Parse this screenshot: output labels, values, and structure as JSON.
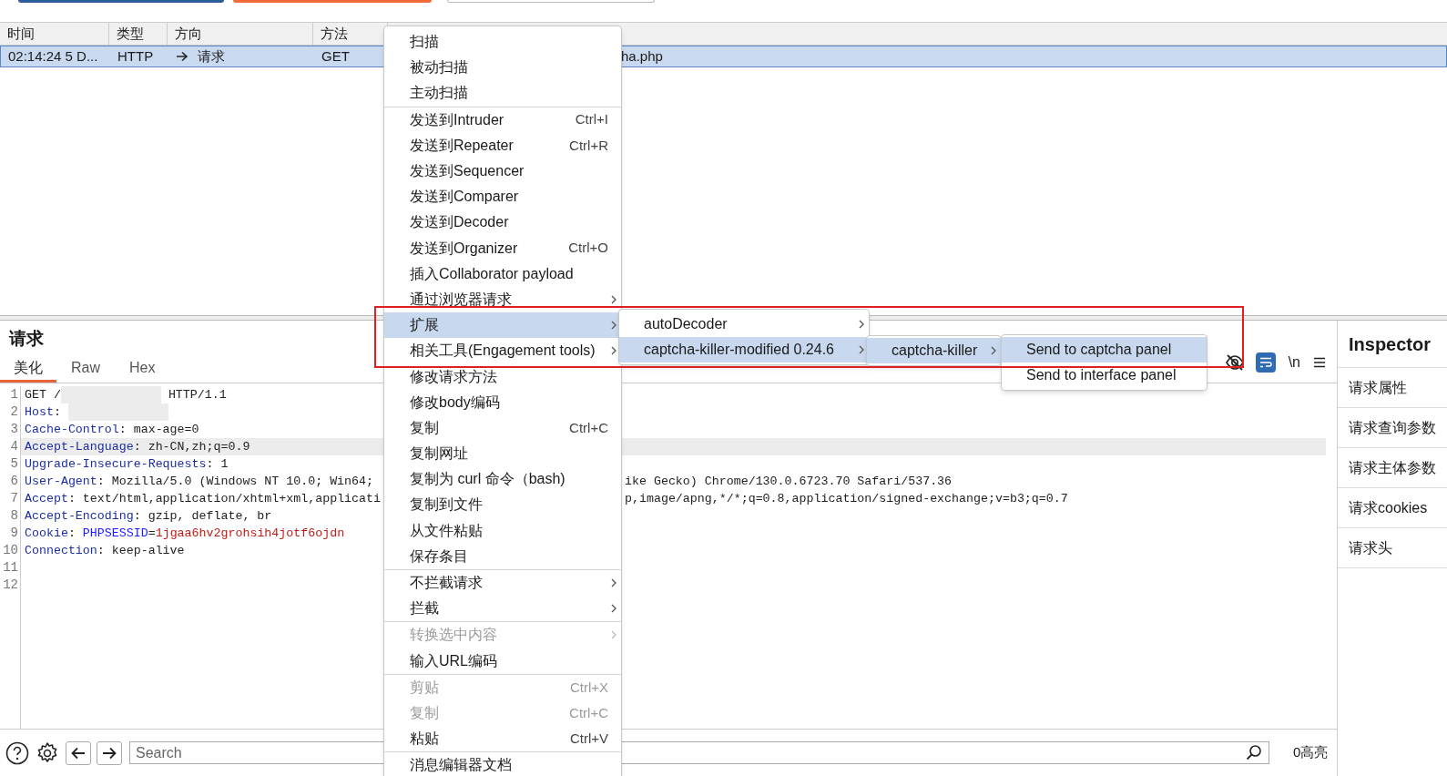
{
  "table": {
    "columns": [
      "时间",
      "类型",
      "方向",
      "方法"
    ],
    "rows": [
      {
        "selected": true,
        "time": "02:14:24 5 D...",
        "type": "HTTP",
        "direction": "请求",
        "method": "GET",
        "column_5": "ha.php"
      }
    ]
  },
  "request": {
    "title": "请求",
    "tabs": [
      {
        "label": "美化",
        "selected": true
      },
      {
        "label": "Raw",
        "selected": false
      },
      {
        "label": "Hex",
        "selected": false
      }
    ],
    "wrap_on": true,
    "newline_label": "\\n",
    "lines": [
      {
        "number": "1",
        "highlighted": false,
        "segments": [
          {
            "kind": "plain",
            "text": "GET /"
          },
          {
            "kind": "redacted"
          },
          {
            "kind": "plain",
            "text": " HTTP/1.1"
          }
        ]
      },
      {
        "number": "2",
        "highlighted": false,
        "segments": [
          {
            "kind": "key",
            "text": "Host"
          },
          {
            "kind": "plain",
            "text": ": "
          },
          {
            "kind": "redacted"
          }
        ]
      },
      {
        "number": "3",
        "highlighted": false,
        "segments": [
          {
            "kind": "key",
            "text": "Cache-Control"
          },
          {
            "kind": "plain",
            "text": ": max-age=0"
          }
        ]
      },
      {
        "number": "4",
        "highlighted": true,
        "segments": [
          {
            "kind": "key",
            "text": "Accept-Language"
          },
          {
            "kind": "plain",
            "text": ": zh-CN,zh;q=0.9"
          }
        ]
      },
      {
        "number": "5",
        "highlighted": false,
        "segments": [
          {
            "kind": "key",
            "text": "Upgrade-Insecure-Requests"
          },
          {
            "kind": "plain",
            "text": ": 1"
          }
        ]
      },
      {
        "number": "6",
        "highlighted": false,
        "segments": [
          {
            "kind": "key",
            "text": "User-Agent"
          },
          {
            "kind": "plain",
            "text": ": Mozilla/5.0 (Windows NT 10.0; Win64;"
          }
        ],
        "continuation": "ike Gecko) Chrome/130.0.6723.70 Safari/537.36"
      },
      {
        "number": "7",
        "highlighted": false,
        "segments": [
          {
            "kind": "key",
            "text": "Accept"
          },
          {
            "kind": "plain",
            "text": ": text/html,application/xhtml+xml,applicati"
          }
        ],
        "continuation": "p,image/apng,*/*;q=0.8,application/signed-exchange;v=b3;q=0.7"
      },
      {
        "number": "8",
        "highlighted": false,
        "segments": [
          {
            "kind": "key",
            "text": "Accept-Encoding"
          },
          {
            "kind": "plain",
            "text": ": gzip, deflate, br"
          }
        ]
      },
      {
        "number": "9",
        "highlighted": false,
        "segments": [
          {
            "kind": "key",
            "text": "Cookie"
          },
          {
            "kind": "plain",
            "text": ": "
          },
          {
            "kind": "param",
            "text": "PHPSESSID"
          },
          {
            "kind": "plain",
            "text": "="
          },
          {
            "kind": "value",
            "text": "1jgaa6hv2grohsih4jotf6ojdn"
          }
        ]
      },
      {
        "number": "10",
        "highlighted": false,
        "segments": [
          {
            "kind": "key",
            "text": "Connection"
          },
          {
            "kind": "plain",
            "text": ": keep-alive"
          }
        ]
      },
      {
        "number": "11",
        "highlighted": false
      },
      {
        "number": "12",
        "highlighted": false
      }
    ]
  },
  "inspector": {
    "title": "Inspector",
    "items": [
      "请求属性",
      "请求查询参数",
      "请求主体参数",
      "请求cookies",
      "请求头"
    ]
  },
  "bottom_bar": {
    "search_placeholder": "Search",
    "highlight_count": "0高亮"
  },
  "context_menu": {
    "items": [
      {
        "kind": "item",
        "label": "扫描",
        "submenu": false,
        "disabled": false,
        "selected": false
      },
      {
        "kind": "item",
        "label": "被动扫描",
        "submenu": false,
        "disabled": false,
        "selected": false
      },
      {
        "kind": "item",
        "label": "主动扫描",
        "submenu": false,
        "disabled": false,
        "selected": false
      },
      {
        "kind": "separator"
      },
      {
        "kind": "item",
        "label": "发送到Intruder",
        "shortcut": "Ctrl+I",
        "submenu": false,
        "disabled": false,
        "selected": false
      },
      {
        "kind": "item",
        "label": "发送到Repeater",
        "shortcut": "Ctrl+R",
        "submenu": false,
        "disabled": false,
        "selected": false
      },
      {
        "kind": "item",
        "label": "发送到Sequencer",
        "submenu": false,
        "disabled": false,
        "selected": false
      },
      {
        "kind": "item",
        "label": "发送到Comparer",
        "submenu": false,
        "disabled": false,
        "selected": false
      },
      {
        "kind": "item",
        "label": "发送到Decoder",
        "submenu": false,
        "disabled": false,
        "selected": false
      },
      {
        "kind": "item",
        "label": "发送到Organizer",
        "shortcut": "Ctrl+O",
        "submenu": false,
        "disabled": false,
        "selected": false
      },
      {
        "kind": "item",
        "label": "插入Collaborator payload",
        "submenu": false,
        "disabled": false,
        "selected": false
      },
      {
        "kind": "item",
        "label": "通过浏览器请求",
        "submenu": true,
        "disabled": false,
        "selected": false
      },
      {
        "kind": "item",
        "label": "扩展",
        "submenu": true,
        "disabled": false,
        "selected": true
      },
      {
        "kind": "item",
        "label": "相关工具(Engagement tools)",
        "submenu": true,
        "disabled": false,
        "selected": false
      },
      {
        "kind": "item",
        "label": "修改请求方法",
        "submenu": false,
        "disabled": false,
        "selected": false
      },
      {
        "kind": "item",
        "label": "修改body编码",
        "submenu": false,
        "disabled": false,
        "selected": false
      },
      {
        "kind": "item",
        "label": "复制",
        "shortcut": "Ctrl+C",
        "submenu": false,
        "disabled": false,
        "selected": false
      },
      {
        "kind": "item",
        "label": "复制网址",
        "submenu": false,
        "disabled": false,
        "selected": false
      },
      {
        "kind": "item",
        "label": "复制为 curl 命令（bash)",
        "submenu": false,
        "disabled": false,
        "selected": false
      },
      {
        "kind": "item",
        "label": "复制到文件",
        "submenu": false,
        "disabled": false,
        "selected": false
      },
      {
        "kind": "item",
        "label": "从文件粘贴",
        "submenu": false,
        "disabled": false,
        "selected": false
      },
      {
        "kind": "item",
        "label": "保存条目",
        "submenu": false,
        "disabled": false,
        "selected": false
      },
      {
        "kind": "separator"
      },
      {
        "kind": "item",
        "label": "不拦截请求",
        "submenu": true,
        "disabled": false,
        "selected": false
      },
      {
        "kind": "item",
        "label": "拦截",
        "submenu": true,
        "disabled": false,
        "selected": false
      },
      {
        "kind": "separator"
      },
      {
        "kind": "item",
        "label": "转换选中内容",
        "submenu": true,
        "disabled": true,
        "selected": false
      },
      {
        "kind": "item",
        "label": "输入URL编码",
        "submenu": false,
        "disabled": false,
        "selected": false
      },
      {
        "kind": "separator"
      },
      {
        "kind": "item",
        "label": "剪贴",
        "shortcut": "Ctrl+X",
        "submenu": false,
        "disabled": true,
        "selected": false
      },
      {
        "kind": "item",
        "label": "复制",
        "shortcut": "Ctrl+C",
        "submenu": false,
        "disabled": true,
        "selected": false
      },
      {
        "kind": "item",
        "label": "粘贴",
        "shortcut": "Ctrl+V",
        "submenu": false,
        "disabled": false,
        "selected": false
      },
      {
        "kind": "separator"
      },
      {
        "kind": "item",
        "label": "消息编辑器文档",
        "submenu": false,
        "disabled": false,
        "selected": false
      }
    ]
  },
  "submenus": [
    {
      "items": [
        {
          "label": "autoDecoder",
          "submenu": true,
          "selected": false
        },
        {
          "label": "captcha-killer-modified 0.24.6",
          "submenu": true,
          "selected": true
        }
      ]
    },
    {
      "items": [
        {
          "label": "captcha-killer",
          "submenu": true,
          "selected": true
        }
      ]
    },
    {
      "items": [
        {
          "label": "Send to captcha panel",
          "submenu": false,
          "selected": true
        },
        {
          "label": "Send to interface panel",
          "submenu": false,
          "selected": false
        }
      ]
    }
  ]
}
